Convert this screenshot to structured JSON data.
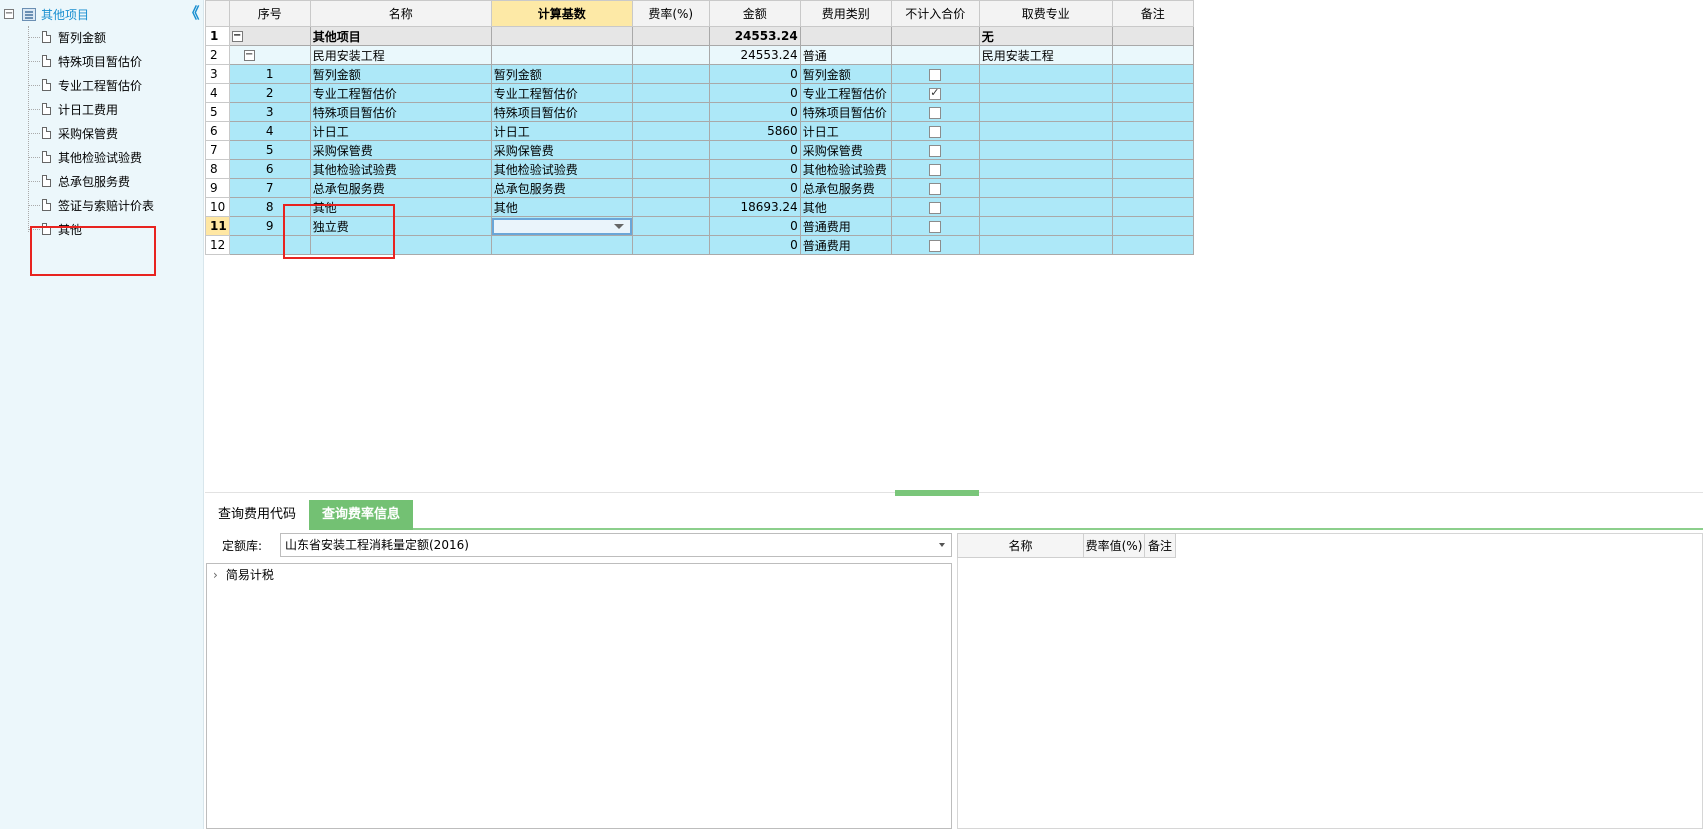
{
  "sidebar": {
    "root_label": "其他项目",
    "root_expander": "−",
    "collapse_glyph": "《",
    "items": [
      {
        "label": "暂列金额"
      },
      {
        "label": "特殊项目暂估价"
      },
      {
        "label": "专业工程暂估价"
      },
      {
        "label": "计日工费用"
      },
      {
        "label": "采购保管费"
      },
      {
        "label": "其他检验试验费"
      },
      {
        "label": "总承包服务费"
      },
      {
        "label": "签证与索赔计价表"
      },
      {
        "label": "其他"
      }
    ]
  },
  "grid": {
    "headers": {
      "seq": "序号",
      "name": "名称",
      "base": "计算基数",
      "rate": "费率(%)",
      "amount": "金额",
      "category": "费用类别",
      "exclude": "不计入合价",
      "specialty": "取费专业",
      "remark": "备注"
    },
    "rows": [
      {
        "rownum": "1",
        "seq": "",
        "name": "其他项目",
        "base": "",
        "rate": "",
        "amount": "24553.24",
        "category": "",
        "specialty": "无",
        "remark": "",
        "expander": "−"
      },
      {
        "rownum": "2",
        "seq": "",
        "name": "民用安装工程",
        "base": "",
        "rate": "",
        "amount": "24553.24",
        "category": "普通",
        "specialty": "民用安装工程",
        "remark": "",
        "expander": "−"
      },
      {
        "rownum": "3",
        "seq": "1",
        "name": "暂列金额",
        "base": "暂列金额",
        "rate": "",
        "amount": "0",
        "category": "暂列金额",
        "specialty": "",
        "remark": "",
        "checked": false
      },
      {
        "rownum": "4",
        "seq": "2",
        "name": "专业工程暂估价",
        "base": "专业工程暂估价",
        "rate": "",
        "amount": "0",
        "category": "专业工程暂估价",
        "specialty": "",
        "remark": "",
        "checked": true
      },
      {
        "rownum": "5",
        "seq": "3",
        "name": "特殊项目暂估价",
        "base": "特殊项目暂估价",
        "rate": "",
        "amount": "0",
        "category": "特殊项目暂估价",
        "specialty": "",
        "remark": "",
        "checked": false
      },
      {
        "rownum": "6",
        "seq": "4",
        "name": "计日工",
        "base": "计日工",
        "rate": "",
        "amount": "5860",
        "category": "计日工",
        "specialty": "",
        "remark": "",
        "checked": false
      },
      {
        "rownum": "7",
        "seq": "5",
        "name": "采购保管费",
        "base": "采购保管费",
        "rate": "",
        "amount": "0",
        "category": "采购保管费",
        "specialty": "",
        "remark": "",
        "checked": false
      },
      {
        "rownum": "8",
        "seq": "6",
        "name": "其他检验试验费",
        "base": "其他检验试验费",
        "rate": "",
        "amount": "0",
        "category": "其他检验试验费",
        "specialty": "",
        "remark": "",
        "checked": false
      },
      {
        "rownum": "9",
        "seq": "7",
        "name": "总承包服务费",
        "base": "总承包服务费",
        "rate": "",
        "amount": "0",
        "category": "总承包服务费",
        "specialty": "",
        "remark": "",
        "checked": false
      },
      {
        "rownum": "10",
        "seq": "8",
        "name": "其他",
        "base": "其他",
        "rate": "",
        "amount": "18693.24",
        "category": "其他",
        "specialty": "",
        "remark": "",
        "checked": false
      },
      {
        "rownum": "11",
        "seq": "9",
        "name": "独立费",
        "base": "",
        "rate": "",
        "amount": "0",
        "category": "普通费用",
        "specialty": "",
        "remark": "",
        "checked": false
      },
      {
        "rownum": "12",
        "seq": "",
        "name": "",
        "base": "",
        "rate": "",
        "amount": "0",
        "category": "普通费用",
        "specialty": "",
        "remark": "",
        "checked": false
      }
    ]
  },
  "tabs": {
    "code_label": "查询费用代码",
    "rate_label": "查询费率信息"
  },
  "quota": {
    "label": "定额库:",
    "value": "山东省安装工程消耗量定额(2016)"
  },
  "rate_tree": {
    "node_label": "简易计税",
    "chevron": "›"
  },
  "rate_table": {
    "headers": {
      "name": "名称",
      "value": "费率值(%)",
      "remark": "备注"
    }
  },
  "colors": {
    "accent_green": "#73c173",
    "row_cyan": "#ade8f8",
    "highlight_header": "#fde9a6",
    "annotation_red": "#e8231f"
  }
}
